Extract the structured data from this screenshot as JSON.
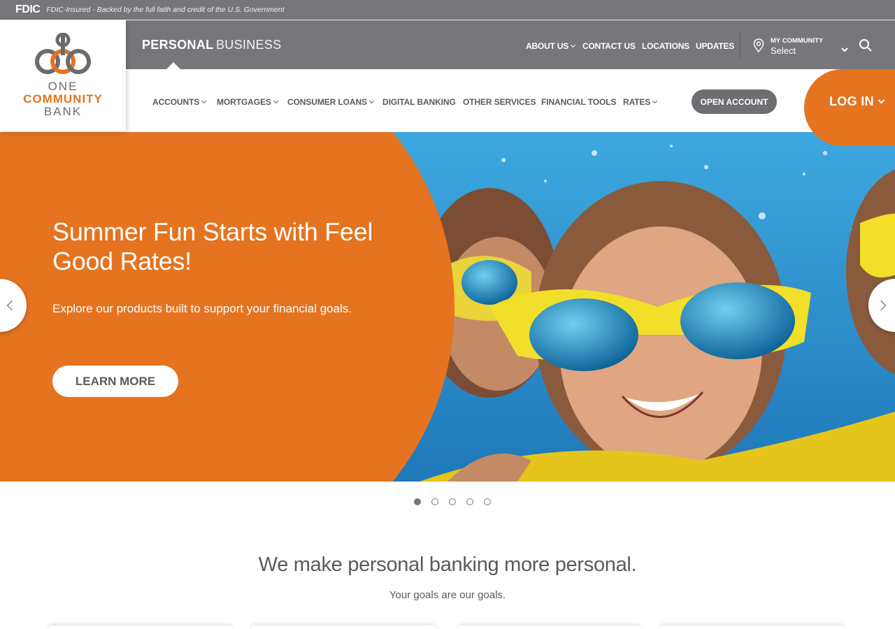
{
  "fdic": {
    "logo": "FDIC",
    "text": "FDIC-Insured - Backed by the full faith and credit of the U.S. Government"
  },
  "brand": {
    "line1": "ONE",
    "line2": "COMMUNITY",
    "line3": "BANK",
    "accent": "#e5731f",
    "gray": "#77777b"
  },
  "segments": {
    "personal": "PERSONAL",
    "business": "BUSINESS"
  },
  "utility_nav": {
    "about": "ABOUT US",
    "contact": "CONTACT US",
    "locations": "LOCATIONS",
    "updates": "UPDATES"
  },
  "community": {
    "small": "MY COMMUNITY",
    "value": "Select"
  },
  "main_nav": {
    "accounts": "ACCOUNTS",
    "mortgages": "MORTGAGES",
    "consumer_loans": "CONSUMER LOANS",
    "digital_banking": "DIGITAL BANKING",
    "other_services": "OTHER SERVICES",
    "financial_tools": "FINANCIAL TOOLS",
    "rates": "RATES",
    "open_account": "OPEN ACCOUNT"
  },
  "login": {
    "label": "LOG IN"
  },
  "hero": {
    "title": "Summer Fun Starts with Feel Good Rates!",
    "subtitle": "Explore our products built to support your financial goals.",
    "cta": "LEARN MORE",
    "slide_count": 5,
    "active_slide": 1
  },
  "section": {
    "title": "We make personal banking more personal.",
    "subtitle": "Your goals are our goals."
  }
}
